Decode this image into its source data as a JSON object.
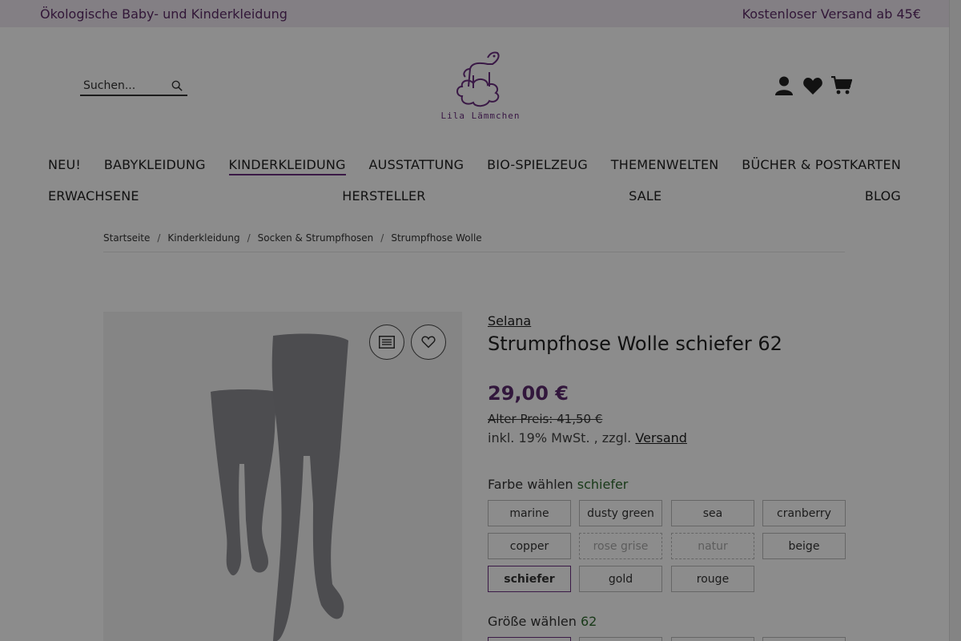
{
  "topbar": {
    "left": "Ökologische Baby- und Kinderkleidung",
    "right": "Kostenloser Versand ab 45€"
  },
  "search": {
    "placeholder": "Suchen..."
  },
  "logo": {
    "text": "Lila Lämmchen"
  },
  "nav": {
    "row1": [
      "NEU!",
      "BABYKLEIDUNG",
      "KINDERKLEIDUNG",
      "AUSSTATTUNG",
      "BIO-SPIELZEUG",
      "THEMENWELTEN",
      "BÜCHER & POSTKARTEN"
    ],
    "row2": [
      "ERWACHSENE",
      "HERSTELLER",
      "SALE",
      "BLOG"
    ],
    "active": "KINDERKLEIDUNG"
  },
  "breadcrumb": [
    "Startseite",
    "Kinderkleidung",
    "Socken & Strumpfhosen",
    "Strumpfhose Wolle"
  ],
  "product": {
    "brand": "Selana",
    "title": "Strumpfhose Wolle schiefer 62",
    "price": "29,00 €",
    "old_price": "Alter Preis: 41,50 €",
    "tax_prefix": "inkl. 19% MwSt. , zzgl.",
    "shipping_link": "Versand"
  },
  "color_option": {
    "label": "Farbe wählen",
    "selected": "schiefer",
    "swatches": [
      {
        "label": "marine",
        "state": "normal"
      },
      {
        "label": "dusty green",
        "state": "normal"
      },
      {
        "label": "sea",
        "state": "normal"
      },
      {
        "label": "cranberry",
        "state": "normal"
      },
      {
        "label": "copper",
        "state": "normal"
      },
      {
        "label": "rose grise",
        "state": "disabled"
      },
      {
        "label": "natur",
        "state": "disabled"
      },
      {
        "label": "beige",
        "state": "normal"
      },
      {
        "label": "schiefer",
        "state": "selected"
      },
      {
        "label": "gold",
        "state": "normal"
      },
      {
        "label": "rouge",
        "state": "normal"
      }
    ]
  },
  "size_option": {
    "label": "Größe wählen",
    "selected": "62"
  },
  "colors": {
    "accent": "#6a2e80",
    "price": "#5b2a6e",
    "selected_value": "#2f6b2f",
    "topbar_bg": "#efe7f1"
  },
  "icons": [
    "search-icon",
    "account-icon",
    "wishlist-heart-icon",
    "cart-icon",
    "compare-list-icon",
    "add-to-wishlist-icon"
  ]
}
